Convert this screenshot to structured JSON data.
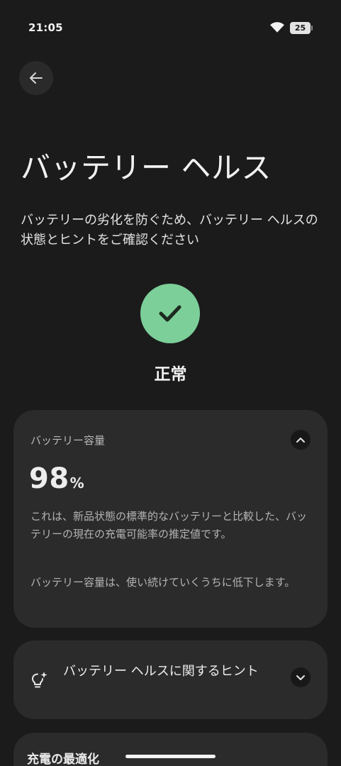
{
  "status_bar": {
    "time": "21:05",
    "battery_level": "25",
    "wifi_icon": "wifi-icon",
    "battery_icon": "battery-icon"
  },
  "back_button": {
    "icon": "arrow-left-icon"
  },
  "header": {
    "title": "バッテリー ヘルス",
    "description": "バッテリーの劣化を防ぐため、バッテリー ヘルスの状態とヒントをご確認ください"
  },
  "health_status": {
    "icon": "checkmark-icon",
    "label": "正常",
    "color": "#7ccf99"
  },
  "capacity_card": {
    "label": "バッテリー容量",
    "value": "98",
    "unit": "%",
    "description_1": "これは、新品状態の標準的なバッテリーと比較した、バッテリーの現在の充電可能率の推定値です。",
    "description_2": "バッテリー容量は、使い続けていくうちに低下します。",
    "toggle_icon": "chevron-up-icon"
  },
  "tips_card": {
    "icon": "lightbulb-sparkle-icon",
    "title": "バッテリー ヘルスに関するヒント",
    "toggle_icon": "chevron-down-icon"
  },
  "charging_card": {
    "title": "充電の最適化"
  },
  "colors": {
    "background": "#1b1b1b",
    "card": "#2b2b2b",
    "accent_green": "#7ccf99"
  }
}
